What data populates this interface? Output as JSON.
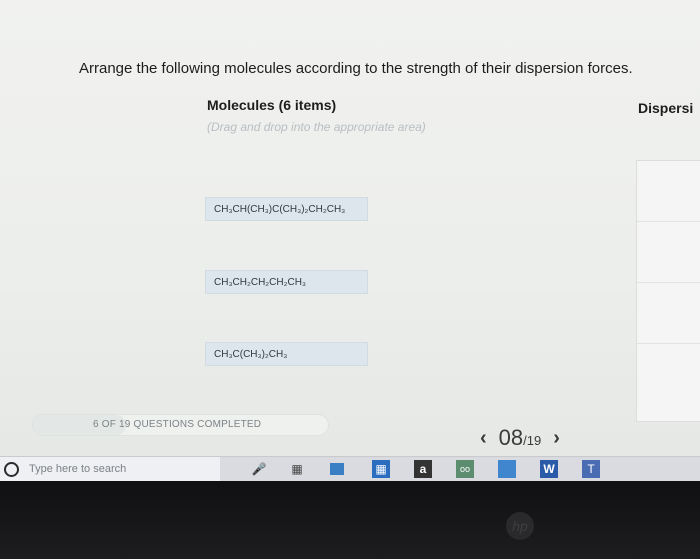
{
  "question": {
    "text": "Arrange the following molecules according to the strength of their dispersion forces."
  },
  "molecules_panel": {
    "title": "Molecules (6 items)",
    "hint": "(Drag and drop into the appropriate area)",
    "items": [
      {
        "label": "CH₃CH(CH₃)C(CH₃)₂CH₂CH₃"
      },
      {
        "label": "CH₃CH₂CH₂CH₂CH₃"
      },
      {
        "label": "CH₃C(CH₃)₂CH₃"
      }
    ]
  },
  "dispersion_panel": {
    "title": "Dispersi"
  },
  "progress": {
    "label": "6 OF 19 QUESTIONS COMPLETED",
    "completed": 6,
    "total": 19
  },
  "pager": {
    "prev": "‹",
    "current": "08",
    "total": "/19",
    "next": "›"
  },
  "taskbar": {
    "search_placeholder": "Type here to search",
    "icons": [
      "microphone-icon",
      "task-view-icon",
      "file-explorer-icon",
      "store-icon",
      "amazon-icon",
      "tripadvisor-icon",
      "edge-icon",
      "word-icon",
      "teams-icon"
    ]
  },
  "colors": {
    "item_bg": "#dde6ec",
    "screen_bg": "#eeefed",
    "taskbar_bg": "#d9dbe0"
  }
}
